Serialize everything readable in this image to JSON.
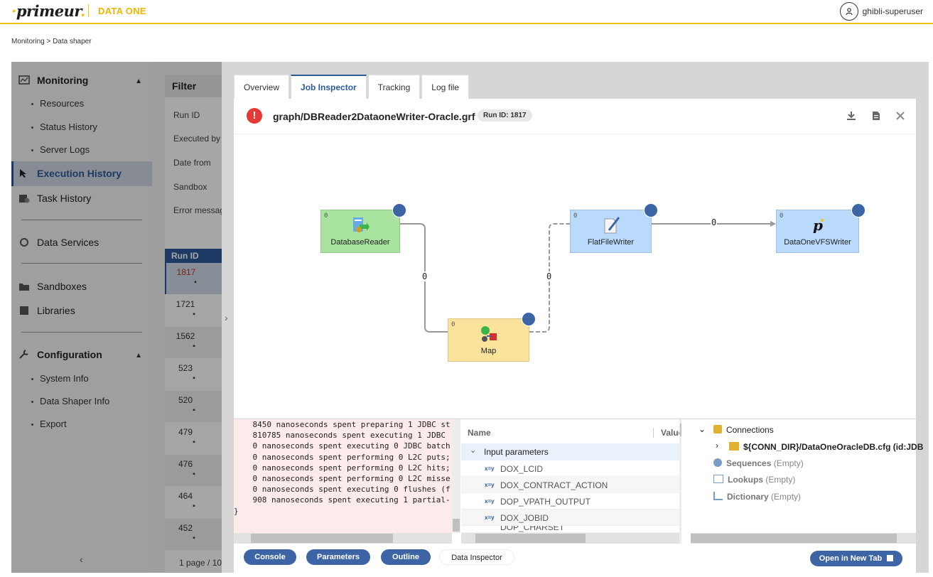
{
  "header": {
    "logo": "primeur",
    "brand": "DATA ONE",
    "user": "ghibli-superuser"
  },
  "breadcrumb": "Monitoring > Data shaper",
  "sidebar": {
    "monitoring": "Monitoring",
    "monitoring_items": [
      "Resources",
      "Status History",
      "Server Logs"
    ],
    "execution_history": "Execution History",
    "task_history": "Task History",
    "data_services": "Data Services",
    "sandboxes": "Sandboxes",
    "libraries": "Libraries",
    "configuration": "Configuration",
    "configuration_items": [
      "System Info",
      "Data Shaper Info",
      "Export"
    ]
  },
  "filter": {
    "title": "Filter",
    "fields": [
      "Run ID",
      "Executed by",
      "Date from",
      "Sandbox",
      "Error message"
    ]
  },
  "runs": {
    "header": "Run ID",
    "ids": [
      "1817",
      "1721",
      "1562",
      "523",
      "520",
      "479",
      "476",
      "464",
      "452"
    ],
    "pager": "1 page / 10"
  },
  "tabs": [
    "Overview",
    "Job Inspector",
    "Tracking",
    "Log file"
  ],
  "graph": {
    "title": "graph/DBReader2DataoneWriter-Oracle.grf",
    "run_id": "Run ID: 1817",
    "nodes": {
      "db": {
        "label": "DatabaseReader",
        "num": "0"
      },
      "map": {
        "label": "Map",
        "num": "0"
      },
      "ff": {
        "label": "FlatFileWriter",
        "num": "0"
      },
      "vfs": {
        "label": "DataOneVFSWriter",
        "num": "0"
      }
    },
    "edges": [
      "0",
      "0",
      "0"
    ]
  },
  "console_lines": [
    "    8450 nanoseconds spent preparing 1 JDBC st",
    "    810785 nanoseconds spent executing 1 JDBC",
    "    0 nanoseconds spent executing 0 JDBC batch",
    "    0 nanoseconds spent performing 0 L2C puts;",
    "    0 nanoseconds spent performing 0 L2C hits;",
    "    0 nanoseconds spent performing 0 L2C misse",
    "    0 nanoseconds spent executing 0 flushes (f",
    "    908 nanoseconds spent executing 1 partial-",
    "}"
  ],
  "params": {
    "name_col": "Name",
    "value_col": "Value",
    "group": "Input parameters",
    "rows": [
      "DOX_LCID",
      "DOX_CONTRACT_ACTION",
      "DOP_VPATH_OUTPUT",
      "DOX_JOBID",
      "DOP_CHARSET"
    ]
  },
  "outline": {
    "connections": "Connections",
    "connection_item": "${CONN_DIR}/DataOneOracleDB.cfg (id:JDB",
    "sequences": "Sequences",
    "lookups": "Lookups",
    "dictionary": "Dictionary",
    "empty": "(Empty)"
  },
  "bottom_buttons": {
    "console": "Console",
    "parameters": "Parameters",
    "outline": "Outline",
    "data_inspector": "Data Inspector",
    "open_new_tab": "Open in New Tab"
  },
  "colors": {
    "accent": "#2b5a9a",
    "brand": "#f1c40f",
    "db_node": "#a8e3a0",
    "map_node": "#fbe39c",
    "writer_node": "#b9dafb",
    "error": "#e53935"
  }
}
